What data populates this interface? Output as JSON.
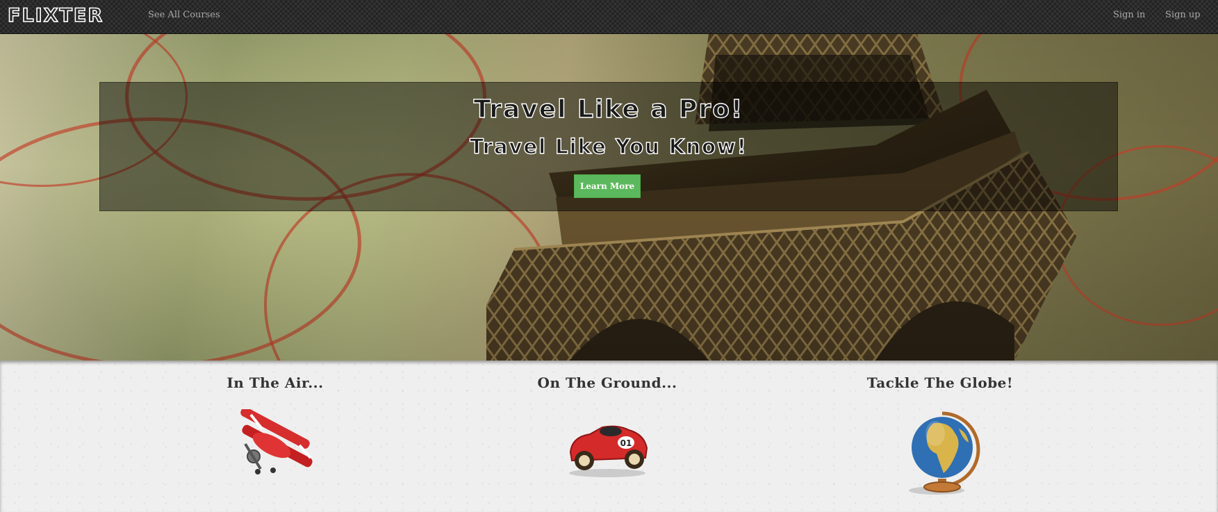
{
  "navbar": {
    "brand": "FLIXTER",
    "see_all_courses": "See All Courses",
    "sign_in": "Sign in",
    "sign_up": "Sign up"
  },
  "hero": {
    "title_line1": "Travel Like a Pro!",
    "title_line2": "Travel Like You Know!",
    "button_label": "Learn More",
    "button_color": "#5cb85c"
  },
  "features": [
    {
      "title": "In The Air...",
      "icon": "airplane-icon"
    },
    {
      "title": "On The Ground...",
      "icon": "race-car-icon"
    },
    {
      "title": "Tackle The Globe!",
      "icon": "globe-icon"
    }
  ],
  "car_number": "01"
}
